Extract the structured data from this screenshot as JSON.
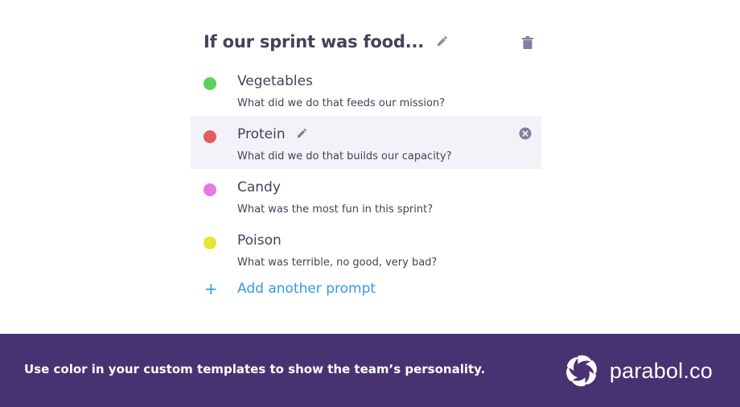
{
  "template": {
    "title": "If our sprint was food...",
    "edit_icon": "pencil-icon",
    "delete_icon": "trash-icon"
  },
  "prompts": [
    {
      "name": "Vegetables",
      "description": "What did we do that feeds our mission?",
      "color": "#5cd15c",
      "active": false
    },
    {
      "name": "Protein",
      "description": "What did we do that builds our capacity?",
      "color": "#e55c5c",
      "active": true
    },
    {
      "name": "Candy",
      "description": "What was the most fun in this sprint?",
      "color": "#e57ae5",
      "active": false
    },
    {
      "name": "Poison",
      "description": "What was terrible, no good, very bad?",
      "color": "#e5e533",
      "active": false
    }
  ],
  "add_prompt": {
    "icon": "plus-icon",
    "label": "Add another prompt"
  },
  "footer": {
    "tagline": "Use color in your custom templates to show the team’s personality.",
    "brand": "parabol.co",
    "background": "#493272"
  },
  "colors": {
    "accent": "#329ae5",
    "text": "#444258",
    "active_row": "#f3f2f9"
  }
}
